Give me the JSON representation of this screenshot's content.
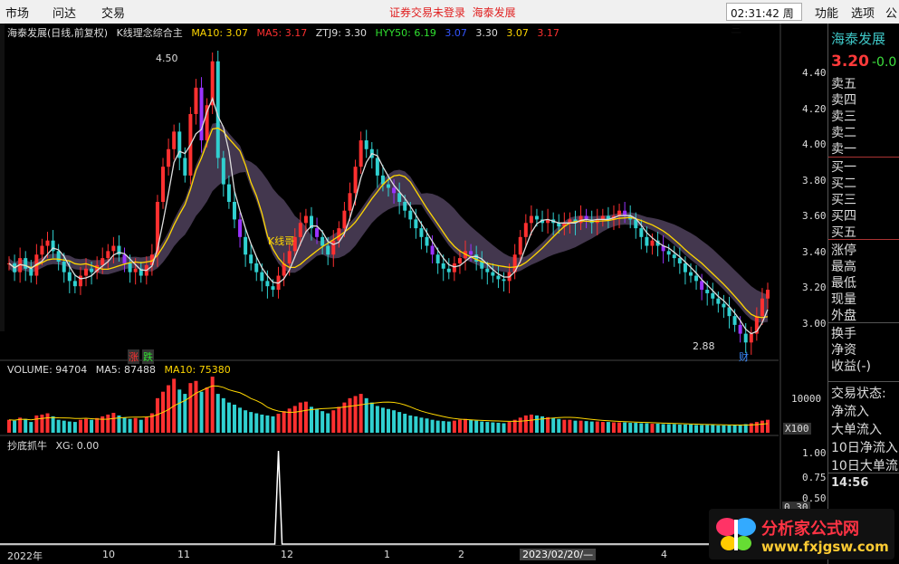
{
  "menu": {
    "left": [
      "市场",
      "问达",
      "交易"
    ],
    "center_status": "证券交易未登录",
    "center_stock": "海泰发展",
    "clock": "02:31:42 周三",
    "right": [
      "功能",
      "选项",
      "公"
    ]
  },
  "main_legend": {
    "title": "海泰发展(日线,前复权)",
    "indicator": "K线理念综合主",
    "ma10": "MA10: 3.07",
    "ma5": "MA5: 3.17",
    "ztj9": "ZTJ9: 3.30",
    "hyy50": "HYY50: 6.19",
    "extra1": "3.07",
    "extra2": "3.30",
    "extra3": "3.07",
    "extra4": "3.17"
  },
  "annotations": {
    "high": "4.50",
    "low": "2.88",
    "kline_label": "K线哥",
    "up_label": "涨",
    "down_label": "跌",
    "cai": "财"
  },
  "price_axis": [
    "4.40",
    "4.20",
    "4.00",
    "3.80",
    "3.60",
    "3.40",
    "3.20",
    "3.00"
  ],
  "volume_legend": {
    "volume": "VOLUME: 94704",
    "ma5": "MA5: 87488",
    "ma10": "MA10: 75380",
    "axis": "10000",
    "unit": "X100"
  },
  "indicator_legend": {
    "name": "抄底抓牛",
    "xg": "XG: 0.00",
    "axis": [
      "1.00",
      "0.75",
      "0.50"
    ],
    "cur": "0.30"
  },
  "date_axis": [
    "2022年",
    "10",
    "11",
    "12",
    "1",
    "2",
    "2023/02/20/—",
    "4"
  ],
  "right_panel": {
    "stock": "海泰发展",
    "price": "3.20",
    "change": "-0.0",
    "rows": [
      "卖五",
      "卖四",
      "卖三",
      "卖二",
      "卖一",
      "买一",
      "买二",
      "买三",
      "买四",
      "买五",
      "涨停",
      "最高",
      "最低",
      "现量",
      "外盘",
      "换手",
      "净资",
      "收益(-)",
      "交易状态:",
      "净流入",
      "大单流入",
      "10日净流入",
      "10日大单流",
      "14:56"
    ]
  },
  "logo": {
    "name": "分析家公式网",
    "url": "www.fxjgsw.com"
  },
  "colors": {
    "up": "#ff3030",
    "down": "#30d0d0",
    "ma10": "#ffd700",
    "cloud": "#5a4a68",
    "cloud2": "#3c4a5c"
  },
  "chart_data": {
    "type": "candlestick",
    "price_range": [
      2.85,
      4.55
    ],
    "closes": [
      3.35,
      3.3,
      3.38,
      3.32,
      3.28,
      3.4,
      3.45,
      3.48,
      3.42,
      3.36,
      3.3,
      3.25,
      3.22,
      3.28,
      3.32,
      3.3,
      3.34,
      3.38,
      3.42,
      3.45,
      3.4,
      3.35,
      3.3,
      3.32,
      3.28,
      3.34,
      3.4,
      3.7,
      3.9,
      4.0,
      4.1,
      3.95,
      3.85,
      4.2,
      4.35,
      4.05,
      4.25,
      4.5,
      3.95,
      3.8,
      3.7,
      3.6,
      3.5,
      3.4,
      3.35,
      3.3,
      3.25,
      3.22,
      3.2,
      3.28,
      3.35,
      3.42,
      3.5,
      3.58,
      3.62,
      3.55,
      3.5,
      3.45,
      3.4,
      3.48,
      3.55,
      3.65,
      3.75,
      3.9,
      4.05,
      4.0,
      3.95,
      3.85,
      3.8,
      3.78,
      3.75,
      3.7,
      3.65,
      3.6,
      3.55,
      3.5,
      3.45,
      3.4,
      3.35,
      3.32,
      3.3,
      3.35,
      3.38,
      3.42,
      3.4,
      3.36,
      3.32,
      3.3,
      3.28,
      3.26,
      3.25,
      3.3,
      3.4,
      3.5,
      3.58,
      3.62,
      3.6,
      3.58,
      3.6,
      3.58,
      3.56,
      3.58,
      3.6,
      3.58,
      3.62,
      3.6,
      3.58,
      3.6,
      3.62,
      3.6,
      3.62,
      3.65,
      3.62,
      3.6,
      3.55,
      3.5,
      3.45,
      3.48,
      3.45,
      3.42,
      3.4,
      3.38,
      3.35,
      3.3,
      3.28,
      3.25,
      3.2,
      3.18,
      3.15,
      3.12,
      3.1,
      3.05,
      3.0,
      2.95,
      2.9,
      2.95,
      3.05,
      3.15,
      3.2
    ],
    "volume": [
      30,
      28,
      35,
      32,
      25,
      40,
      42,
      45,
      38,
      30,
      28,
      26,
      25,
      30,
      32,
      30,
      34,
      38,
      42,
      46,
      40,
      35,
      32,
      34,
      30,
      36,
      45,
      80,
      95,
      110,
      125,
      100,
      90,
      115,
      120,
      95,
      105,
      130,
      90,
      80,
      70,
      65,
      58,
      52,
      48,
      45,
      42,
      40,
      38,
      44,
      50,
      56,
      62,
      70,
      72,
      60,
      55,
      50,
      45,
      52,
      60,
      70,
      80,
      85,
      90,
      80,
      70,
      62,
      58,
      55,
      52,
      48,
      44,
      40,
      38,
      35,
      33,
      30,
      28,
      27,
      26,
      28,
      30,
      32,
      30,
      28,
      26,
      25,
      24,
      23,
      22,
      25,
      30,
      35,
      40,
      42,
      40,
      38,
      36,
      34,
      32,
      30,
      30,
      28,
      28,
      27,
      26,
      26,
      25,
      25,
      24,
      24,
      24,
      23,
      23,
      22,
      22,
      21,
      21,
      20,
      20,
      20,
      19,
      19,
      19,
      18,
      18,
      18,
      18,
      17,
      17,
      17,
      17,
      18,
      20,
      22,
      25,
      28,
      30
    ],
    "spike_index": 52
  }
}
